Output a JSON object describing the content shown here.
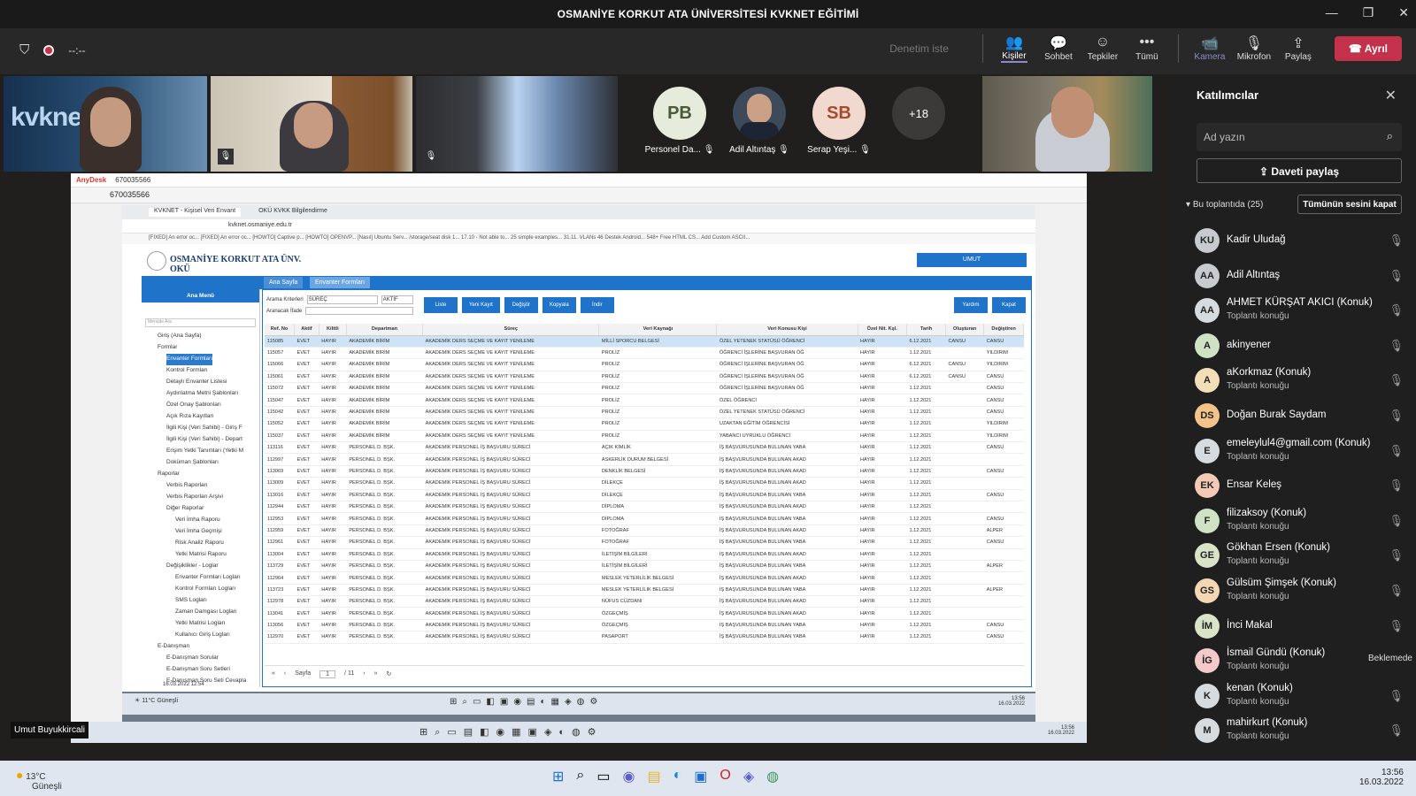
{
  "window": {
    "title": "OSMANİYE KORKUT ATA ÜNİVERSİTESİ KVKNET EĞİTİMİ",
    "minimize": "—",
    "restore": "❐",
    "close": "✕"
  },
  "toolbar": {
    "timer": "--:--",
    "request_control": "Denetim iste",
    "people": "Kişiler",
    "chat": "Sohbet",
    "reactions": "Tepkiler",
    "more": "Tümü",
    "camera": "Kamera",
    "mic": "Mikrofon",
    "share": "Paylaş",
    "leave": "Ayrıl"
  },
  "gallery": {
    "kvknet_logo": "kvknet",
    "tiles": [
      {
        "initials": "PB",
        "name": "Personel Da...",
        "color": "#e6ebdc"
      },
      {
        "initials": "",
        "name": "Adil Altıntaş",
        "color": "#3c4a5a"
      },
      {
        "initials": "SB",
        "name": "Serap Yeşi...",
        "color": "#f2d9d0"
      }
    ],
    "overflow": "+18"
  },
  "participants_panel": {
    "title": "Katılımcılar",
    "search_placeholder": "Ad yazın",
    "share_invite": "Daveti paylaş",
    "in_meeting": "Bu toplantıda (25)",
    "mute_all": "Tümünün sesini kapat",
    "list": [
      {
        "initials": "KU",
        "name": "Kadir Uludağ",
        "sub": "",
        "color": "#c7cbd0"
      },
      {
        "initials": "AA",
        "name": "Adil Altıntaş",
        "sub": "",
        "color": "#c7cbd0"
      },
      {
        "initials": "AA",
        "name": "AHMET KÜRŞAT AKICI (Konuk)",
        "sub": "Toplantı konuğu",
        "color": "#d6dbe0"
      },
      {
        "initials": "A",
        "name": "akinyener",
        "sub": "",
        "color": "#cfe3c4"
      },
      {
        "initials": "A",
        "name": "aKorkmaz (Konuk)",
        "sub": "Toplantı konuğu",
        "color": "#f3dfb7"
      },
      {
        "initials": "DS",
        "name": "Doğan Burak Saydam",
        "sub": "",
        "color": "#f3c38a"
      },
      {
        "initials": "E",
        "name": "emeleylul4@gmail.com (Konuk)",
        "sub": "Toplantı konuğu",
        "color": "#d6dbe0"
      },
      {
        "initials": "EK",
        "name": "Ensar Keleş",
        "sub": "",
        "color": "#f4c9b5"
      },
      {
        "initials": "F",
        "name": "filizaksoy (Konuk)",
        "sub": "Toplantı konuğu",
        "color": "#cfe3c4"
      },
      {
        "initials": "GE",
        "name": "Gökhan Ersen (Konuk)",
        "sub": "Toplantı konuğu",
        "color": "#d8e3c8"
      },
      {
        "initials": "GS",
        "name": "Gülsüm Şimşek (Konuk)",
        "sub": "Toplantı konuğu",
        "color": "#f3d7b5"
      },
      {
        "initials": "İM",
        "name": "İnci Makal",
        "sub": "",
        "color": "#d8e3c8"
      },
      {
        "initials": "İG",
        "name": "İsmail Gündü (Konuk)",
        "sub": "Toplantı konuğu",
        "color": "#f4c9c9",
        "status": "Beklemede"
      },
      {
        "initials": "K",
        "name": "kenan (Konuk)",
        "sub": "Toplantı konuğu",
        "color": "#d6dbe0"
      },
      {
        "initials": "M",
        "name": "mahirkurt (Konuk)",
        "sub": "Toplantı konuğu",
        "color": "#d6dbe0"
      }
    ]
  },
  "speaker_nameplate": "Umut Buyukkircali",
  "remote": {
    "anydesk_tab": "AnyDesk",
    "session_tab": "670035566",
    "address": "670035566",
    "browser_tabs": [
      "KVKNET - Kişisel Veri Envant",
      "OKÜ KVKK Bilgilendirme"
    ],
    "url": "kvknet.osmaniye.edu.tr",
    "bookmarks": "[FIXED] An error oc...   [FIXED] An error oc...   [HOWTO] Captive p...   [HOWTO] OPENVP...   [Nasıl] Ubuntu Serv...   /storage/seat disk 1...   17.10 - Not able to...   25 simple examples...   31.11. VLANs   46 Destek Android...   548+ Free HTML CS...   Add Custom ASCII...",
    "app_title_1": "OSMANİYE KORKUT ATA ÜNV.",
    "app_title_2": "OKÜ",
    "user_button": "UMUT",
    "nav_home": "Ana Sayfa",
    "nav_inventory": "Envanter Formları",
    "menu_head": "Ana Menü",
    "menu_search": "Menüde Ara",
    "menu": [
      "Giriş (Ana Sayfa)",
      "Formlar",
      "Envanter Formları",
      "Kontrol Formları",
      "Detaylı Envanter Listesi",
      "Aydınlatma Metni Şablonları",
      "Özel Onay Şablonları",
      "Açık Rıza Kayıtları",
      "İlgili Kişi (Veri Sahibi) - Giriş F",
      "İlgili Kişi (Veri Sahibi) - Depart",
      "Erişim Yetki Tanımları (Yetki M",
      "Doküman Şablonları",
      "Raporlar",
      "Verbis Raporları",
      "Verbis Raporları Arşivi",
      "Diğer Raporlar",
      "Veri İmha Raporu",
      "Veri İmha Geçmişi",
      "Risk Analiz Raporu",
      "Yetki Matrisi Raporu",
      "Değişiklikler - Loglar",
      "Envanter Formları Logları",
      "Kontrol Formları Logları",
      "SMS Logları",
      "Zaman Damgası Logları",
      "Yetki Matrisi Logları",
      "Kullanıcı Giriş Logları",
      "E-Danışman",
      "E-Danışman Sorular",
      "E-Danışman Soru Setleri",
      "E-Danışman Soru Seti Cevapla"
    ],
    "menu_date": "16.03.2022 12:54",
    "filter_label_1": "Arama Kriterleri",
    "filter_label_2": "Aranacak İfade",
    "filter_select_1": "SÜREÇ",
    "filter_select_2": "AKTİF",
    "buttons": [
      "Liste",
      "Yeni Kayıt",
      "Değiştir",
      "Kopyala",
      "İndir"
    ],
    "help": "Yardım",
    "close": "Kapat",
    "columns": [
      "Ref. No",
      "Aktif",
      "Kilitli",
      "Departman",
      "Süreç",
      "Veri Kaynağı",
      "Veri Konusu Kişi",
      "Özel Nit. Kşl.",
      "Tarih",
      "Oluşturan",
      "Değiştiren"
    ],
    "rows": [
      [
        "115085",
        "EVET",
        "HAYIR",
        "AKADEMİK BİRİM",
        "AKADEMİK DERS SEÇME VE KAYIT YENİLEME",
        "MİLLİ SPORCU BELGESİ",
        "ÖZEL YETENEK STATÜSÜ ÖĞRENCİ",
        "HAYIR",
        "6.12.2021",
        "CANSU",
        "CANSU"
      ],
      [
        "115057",
        "EVET",
        "HAYIR",
        "AKADEMİK BİRİM",
        "AKADEMİK DERS SEÇME VE KAYIT YENİLEME",
        "PROLİZ",
        "ÖĞRENCİ İŞLERİNE BAŞVURAN ÖĞ",
        "HAYIR",
        "1.12.2021",
        "",
        "YILDIRIM"
      ],
      [
        "115066",
        "EVET",
        "HAYIR",
        "AKADEMİK BİRİM",
        "AKADEMİK DERS SEÇME VE KAYIT YENİLEME",
        "PROLİZ",
        "ÖĞRENCİ İŞLERİNE BAŞVURAN ÖĞ",
        "HAYIR",
        "6.12.2021",
        "CANSU",
        "YILDIRIM"
      ],
      [
        "115061",
        "EVET",
        "HAYIR",
        "AKADEMİK BİRİM",
        "AKADEMİK DERS SEÇME VE KAYIT YENİLEME",
        "PROLİZ",
        "ÖĞRENCİ İŞLERİNE BAŞVURAN ÖĞ",
        "HAYIR",
        "6.12.2021",
        "CANSU",
        "CANSU"
      ],
      [
        "115072",
        "EVET",
        "HAYIR",
        "AKADEMİK BİRİM",
        "AKADEMİK DERS SEÇME VE KAYIT YENİLEME",
        "PROLİZ",
        "ÖĞRENCİ İŞLERİNE BAŞVURAN ÖĞ",
        "HAYIR",
        "1.12.2021",
        "",
        "CANSU"
      ],
      [
        "115047",
        "EVET",
        "HAYIR",
        "AKADEMİK BİRİM",
        "AKADEMİK DERS SEÇME VE KAYIT YENİLEME",
        "PROLİZ",
        "ÖZEL ÖĞRENCİ",
        "HAYIR",
        "1.12.2021",
        "",
        "CANSU"
      ],
      [
        "115042",
        "EVET",
        "HAYIR",
        "AKADEMİK BİRİM",
        "AKADEMİK DERS SEÇME VE KAYIT YENİLEME",
        "PROLİZ",
        "ÖZEL YETENEK STATÜSÜ ÖĞRENCİ",
        "HAYIR",
        "1.12.2021",
        "",
        "CANSU"
      ],
      [
        "115052",
        "EVET",
        "HAYIR",
        "AKADEMİK BİRİM",
        "AKADEMİK DERS SEÇME VE KAYIT YENİLEME",
        "PROLİZ",
        "UZAKTAN EĞİTİM ÖĞRENCİSİ",
        "HAYIR",
        "1.12.2021",
        "",
        "YILDIRIM"
      ],
      [
        "115037",
        "EVET",
        "HAYIR",
        "AKADEMİK BİRİM",
        "AKADEMİK DERS SEÇME VE KAYIT YENİLEME",
        "PROLİZ",
        "YABANCI UYRUKLU ÖĞRENCİ",
        "HAYIR",
        "1.12.2021",
        "",
        "YILDIRIM"
      ],
      [
        "113116",
        "EVET",
        "HAYIR",
        "PERSONEL D. BŞK.",
        "AKADEMİK PERSONEL İŞ BAŞVURU SÜRECİ",
        "AÇIK KİMLİK",
        "İŞ BAŞVURUSUNDA BULUNAN YABA",
        "HAYIR",
        "1.12.2021",
        "",
        "CANSU"
      ],
      [
        "112997",
        "EVET",
        "HAYIR",
        "PERSONEL D. BŞK.",
        "AKADEMİK PERSONEL İŞ BAŞVURU SÜRECİ",
        "ASKERLİK DURUM BELGESİ",
        "İŞ BAŞVURUSUNDA BULUNAN AKAD",
        "HAYIR",
        "1.12.2021",
        "",
        ""
      ],
      [
        "113069",
        "EVET",
        "HAYIR",
        "PERSONEL D. BŞK.",
        "AKADEMİK PERSONEL İŞ BAŞVURU SÜRECİ",
        "DENKLİK BELGESİ",
        "İŞ BAŞVURUSUNDA BULUNAN AKAD",
        "HAYIR",
        "1.12.2021",
        "",
        "CANSU"
      ],
      [
        "113009",
        "EVET",
        "HAYIR",
        "PERSONEL D. BŞK.",
        "AKADEMİK PERSONEL İŞ BAŞVURU SÜRECİ",
        "DİLEKÇE",
        "İŞ BAŞVURUSUNDA BULUNAN AKAD",
        "HAYIR",
        "1.12.2021",
        "",
        ""
      ],
      [
        "113016",
        "EVET",
        "HAYIR",
        "PERSONEL D. BŞK.",
        "AKADEMİK PERSONEL İŞ BAŞVURU SÜRECİ",
        "DİLEKÇE",
        "İŞ BAŞVURUSUNDA BULUNAN YABA",
        "HAYIR",
        "1.12.2021",
        "",
        "CANSU"
      ],
      [
        "112944",
        "EVET",
        "HAYIR",
        "PERSONEL D. BŞK.",
        "AKADEMİK PERSONEL İŞ BAŞVURU SÜRECİ",
        "DİPLOMA",
        "İŞ BAŞVURUSUNDA BULUNAN AKAD",
        "HAYIR",
        "1.12.2021",
        "",
        ""
      ],
      [
        "112953",
        "EVET",
        "HAYIR",
        "PERSONEL D. BŞK.",
        "AKADEMİK PERSONEL İŞ BAŞVURU SÜRECİ",
        "DİPLOMA",
        "İŞ BAŞVURUSUNDA BULUNAN YABA",
        "HAYIR",
        "1.12.2021",
        "",
        "CANSU"
      ],
      [
        "112959",
        "EVET",
        "HAYIR",
        "PERSONEL D. BŞK.",
        "AKADEMİK PERSONEL İŞ BAŞVURU SÜRECİ",
        "FOTOĞRAF",
        "İŞ BAŞVURUSUNDA BULUNAN AKAD",
        "HAYIR",
        "1.12.2021",
        "",
        "ALPER"
      ],
      [
        "112961",
        "EVET",
        "HAYIR",
        "PERSONEL D. BŞK.",
        "AKADEMİK PERSONEL İŞ BAŞVURU SÜRECİ",
        "FOTOĞRAF",
        "İŞ BAŞVURUSUNDA BULUNAN YABA",
        "HAYIR",
        "1.12.2021",
        "",
        "CANSU"
      ],
      [
        "113004",
        "EVET",
        "HAYIR",
        "PERSONEL D. BŞK.",
        "AKADEMİK PERSONEL İŞ BAŞVURU SÜRECİ",
        "İLETİŞİM BİLGİLERİ",
        "İŞ BAŞVURUSUNDA BULUNAN AKAD",
        "HAYIR",
        "1.12.2021",
        "",
        ""
      ],
      [
        "113729",
        "EVET",
        "HAYIR",
        "PERSONEL D. BŞK.",
        "AKADEMİK PERSONEL İŞ BAŞVURU SÜRECİ",
        "İLETİŞİM BİLGİLERİ",
        "İŞ BAŞVURUSUNDA BULUNAN YABA",
        "HAYIR",
        "1.12.2021",
        "",
        "ALPER"
      ],
      [
        "112964",
        "EVET",
        "HAYIR",
        "PERSONEL D. BŞK.",
        "AKADEMİK PERSONEL İŞ BAŞVURU SÜRECİ",
        "MESLEK YETERLİLİK BELGESİ",
        "İŞ BAŞVURUSUNDA BULUNAN AKAD",
        "HAYIR",
        "1.12.2021",
        "",
        ""
      ],
      [
        "113723",
        "EVET",
        "HAYIR",
        "PERSONEL D. BŞK.",
        "AKADEMİK PERSONEL İŞ BAŞVURU SÜRECİ",
        "MESLEK YETERLİLİK BELGESİ",
        "İŞ BAŞVURUSUNDA BULUNAN YABA",
        "HAYIR",
        "1.12.2021",
        "",
        "ALPER"
      ],
      [
        "112978",
        "EVET",
        "HAYIR",
        "PERSONEL D. BŞK.",
        "AKADEMİK PERSONEL İŞ BAŞVURU SÜRECİ",
        "NÜFUS CÜZDANI",
        "İŞ BAŞVURUSUNDA BULUNAN AKAD",
        "HAYIR",
        "1.12.2021",
        "",
        ""
      ],
      [
        "113041",
        "EVET",
        "HAYIR",
        "PERSONEL D. BŞK.",
        "AKADEMİK PERSONEL İŞ BAŞVURU SÜRECİ",
        "ÖZGEÇMİŞ",
        "İŞ BAŞVURUSUNDA BULUNAN AKAD",
        "HAYIR",
        "1.12.2021",
        "",
        ""
      ],
      [
        "113056",
        "EVET",
        "HAYIR",
        "PERSONEL D. BŞK.",
        "AKADEMİK PERSONEL İŞ BAŞVURU SÜRECİ",
        "ÖZGEÇMİŞ",
        "İŞ BAŞVURUSUNDA BULUNAN YABA",
        "HAYIR",
        "1.12.2021",
        "",
        "CANSU"
      ],
      [
        "112970",
        "EVET",
        "HAYIR",
        "PERSONEL D. BŞK.",
        "AKADEMİK PERSONEL İŞ BAŞVURU SÜRECİ",
        "PASAPORT",
        "İŞ BAŞVURUSUNDA BULUNAN YABA",
        "HAYIR",
        "1.12.2021",
        "",
        "CANSU"
      ]
    ],
    "pager_label": "Sayfa",
    "pager_page": "1",
    "pager_total": "/ 11",
    "weather_temp": "11°C",
    "weather_text": "Güneşli",
    "inner_time": "13:56",
    "inner_date": "16.03.2022"
  },
  "taskbar": {
    "temp": "13°C",
    "weather": "Güneşli",
    "time": "13:56",
    "date": "16.03.2022"
  }
}
